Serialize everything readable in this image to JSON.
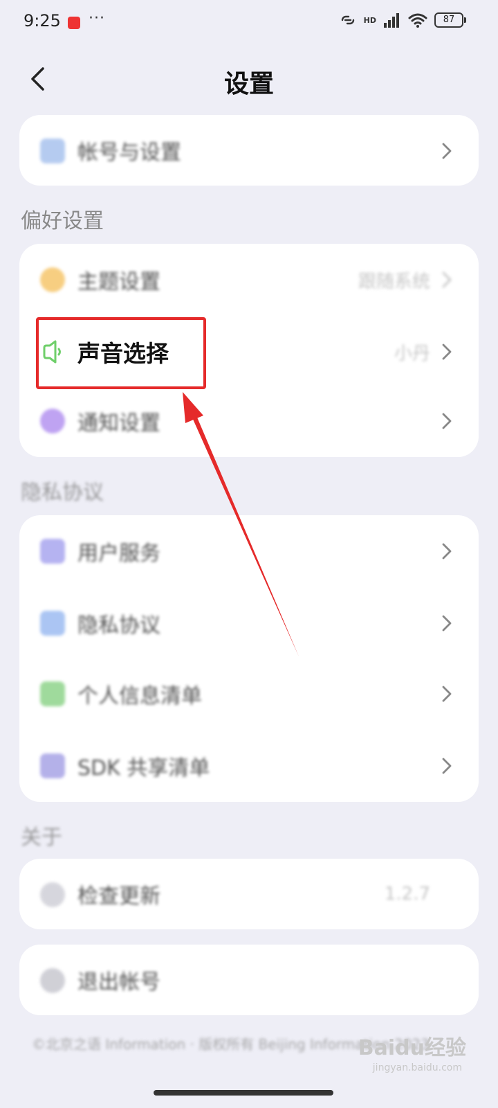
{
  "status_bar": {
    "time": "9:25",
    "more": "···",
    "battery": "87",
    "network": "HD"
  },
  "nav": {
    "title": "设置"
  },
  "account_card": {
    "label": "帐号与设置"
  },
  "preferences": {
    "section_title": "偏好设置",
    "items": [
      {
        "label": "主题设置",
        "value": "跟随系统",
        "icon_color": "#f6c66c"
      },
      {
        "label": "声音选择",
        "value": "小丹",
        "icon_color": "#6fcf6a"
      },
      {
        "label": "通知设置",
        "icon_color": "#b493f0"
      }
    ]
  },
  "privacy": {
    "section_title": "隐私协议",
    "items": [
      {
        "label": "用户服务",
        "icon_color": "#a9a6ef"
      },
      {
        "label": "隐私协议",
        "icon_color": "#9dbcf1"
      },
      {
        "label": "个人信息清单",
        "icon_color": "#8fd48b"
      },
      {
        "label": "SDK 共享清单",
        "icon_color": "#a8a4e6"
      }
    ]
  },
  "about": {
    "section_title": "关于",
    "items": [
      {
        "label": "检查更新",
        "value": "1.2.7"
      }
    ]
  },
  "logout": {
    "label": "退出帐号"
  },
  "footer": {
    "text": "©北京之语 Information · 版权所有 Beijing Information 2023",
    "watermark": "Baidu经验",
    "watermark_sub": "jingyan.baidu.com"
  },
  "colors": {
    "highlight": "#e52a2a",
    "background": "#eeeef6"
  }
}
